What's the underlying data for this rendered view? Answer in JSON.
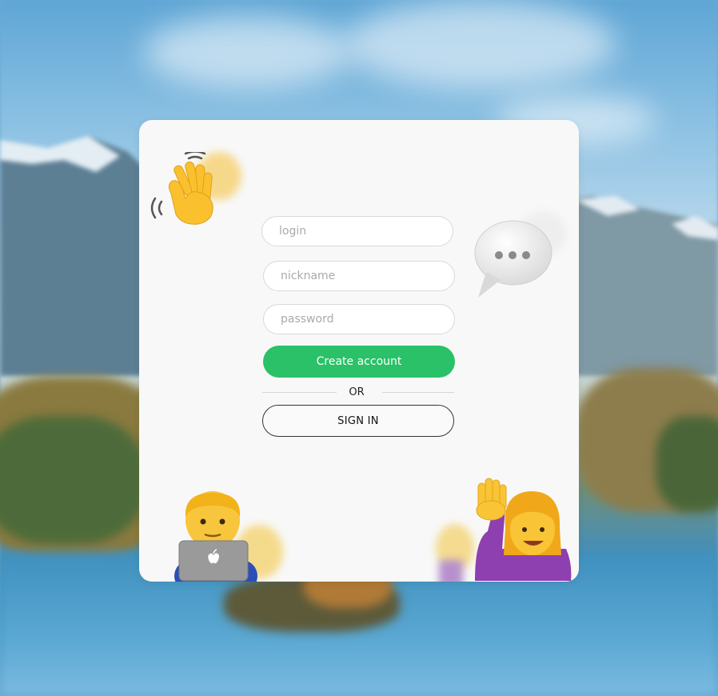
{
  "auth": {
    "login_placeholder": "login",
    "nickname_placeholder": "nickname",
    "password_placeholder": "password",
    "create_label": "Create account",
    "or_label": "OR",
    "signin_label": "SIGN IN"
  },
  "colors": {
    "create_button": "#2ac168",
    "card_background": "#f8f8f8"
  },
  "decorations": [
    "waving-hand-icon",
    "speech-bubble-icon",
    "man-technologist-icon",
    "woman-raising-hand-icon"
  ]
}
